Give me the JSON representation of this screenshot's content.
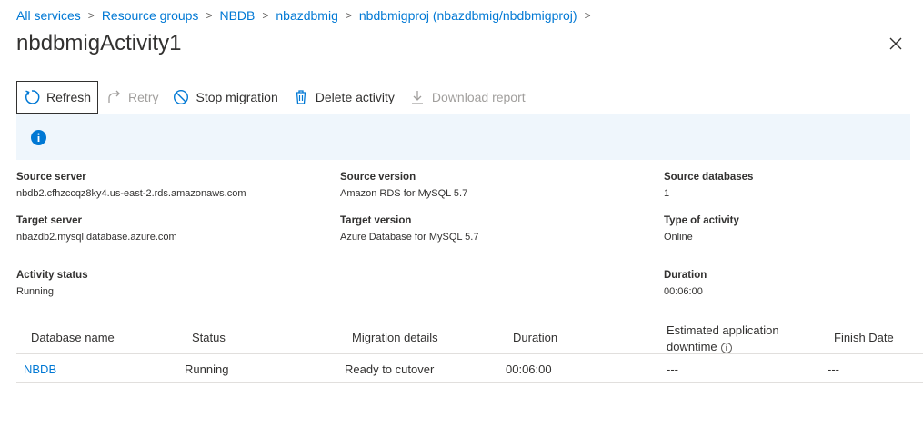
{
  "breadcrumb": {
    "items": [
      "All services",
      "Resource groups",
      "NBDB",
      "nbazdbmig",
      "nbdbmigproj (nbazdbmig/nbdbmigproj)"
    ]
  },
  "page": {
    "title": "nbdbmigActivity1"
  },
  "toolbar": {
    "refresh": "Refresh",
    "retry": "Retry",
    "stop": "Stop migration",
    "delete": "Delete activity",
    "download": "Download report"
  },
  "properties": {
    "source_server": {
      "label": "Source server",
      "value": "nbdb2.cfhzccqz8ky4.us-east-2.rds.amazonaws.com"
    },
    "source_version": {
      "label": "Source version",
      "value": "Amazon RDS for MySQL 5.7"
    },
    "source_databases": {
      "label": "Source databases",
      "value": "1"
    },
    "target_server": {
      "label": "Target server",
      "value": "nbazdb2.mysql.database.azure.com"
    },
    "target_version": {
      "label": "Target version",
      "value": "Azure Database for MySQL 5.7"
    },
    "type_of_activity": {
      "label": "Type of activity",
      "value": "Online"
    },
    "activity_status": {
      "label": "Activity status",
      "value": "Running"
    },
    "duration": {
      "label": "Duration",
      "value": "00:06:00"
    }
  },
  "grid": {
    "headers": {
      "database_name": "Database name",
      "status": "Status",
      "migration_details": "Migration details",
      "duration": "Duration",
      "downtime_line1": "Estimated application",
      "downtime_line2": "downtime",
      "finish_date": "Finish Date"
    },
    "rows": [
      {
        "database_name": "NBDB",
        "status": "Running",
        "migration_details": "Ready to cutover",
        "duration": "00:06:00",
        "downtime": "---",
        "finish_date": "---"
      }
    ]
  },
  "colors": {
    "link": "#0078d4",
    "info_bar": "#eff6fc",
    "disabled": "#a19f9d"
  }
}
